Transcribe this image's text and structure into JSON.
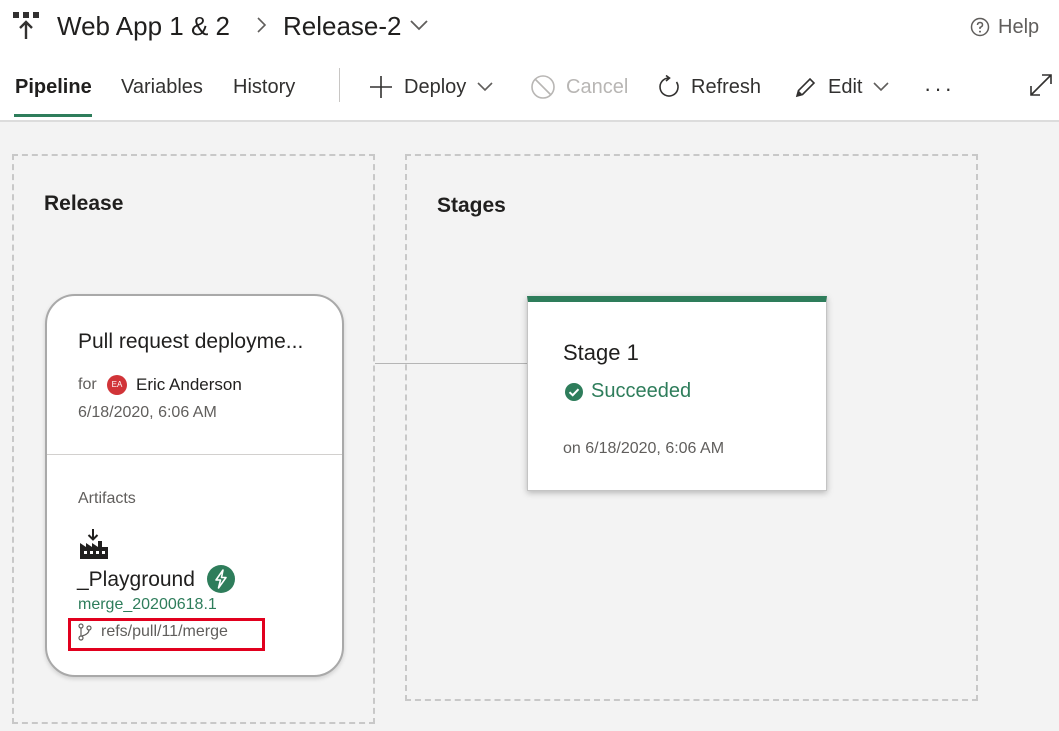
{
  "header": {
    "pipeline_name": "Web App 1 & 2",
    "release_name": "Release-2",
    "help_label": "Help"
  },
  "tabs": [
    {
      "label": "Pipeline",
      "active": true
    },
    {
      "label": "Variables",
      "active": false
    },
    {
      "label": "History",
      "active": false
    }
  ],
  "toolbar": {
    "deploy_label": "Deploy",
    "cancel_label": "Cancel",
    "refresh_label": "Refresh",
    "edit_label": "Edit",
    "more_label": "···"
  },
  "release_section": {
    "title": "Release",
    "card": {
      "title": "Pull request deployme...",
      "for_label": "for",
      "user_name": "Eric Anderson",
      "avatar_initials": "EA",
      "date": "6/18/2020, 6:06 AM",
      "artifacts_label": "Artifacts",
      "artifact_name": "_Playground",
      "artifact_version": "merge_20200618.1",
      "branch": "refs/pull/11/merge"
    }
  },
  "stages_section": {
    "title": "Stages",
    "stages": [
      {
        "name": "Stage 1",
        "status": "Succeeded",
        "date": "on 6/18/2020, 6:06 AM"
      }
    ]
  },
  "colors": {
    "accent_green": "#2e7d5b",
    "highlight_red": "#e1001e",
    "avatar_red": "#d13438"
  },
  "icons": [
    "pipeline-icon",
    "chevron-right-icon",
    "chevron-down-icon",
    "help-icon",
    "plus-icon",
    "cancel-icon",
    "refresh-icon",
    "edit-pencil-icon",
    "expand-icon",
    "build-artifact-icon",
    "trigger-lightning-icon",
    "branch-icon",
    "success-check-icon"
  ]
}
